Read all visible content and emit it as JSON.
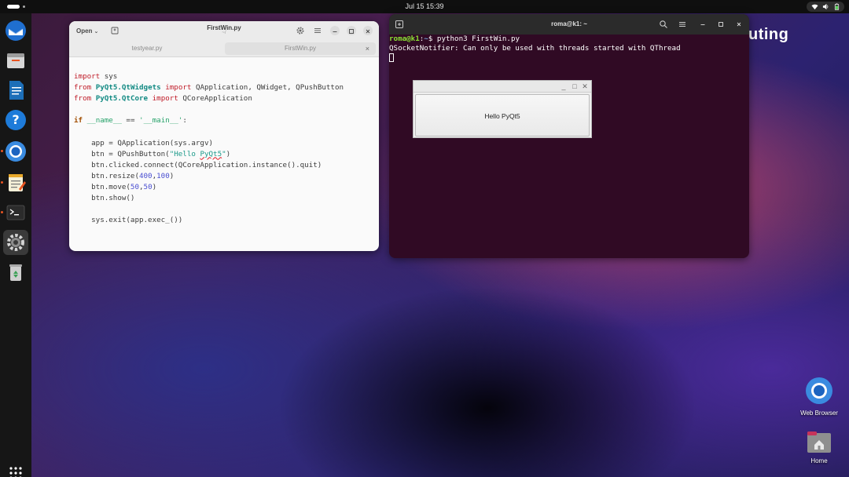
{
  "topbar": {
    "clock": "Jul 15  15:39"
  },
  "dock": {
    "items": [
      {
        "name": "thunderbird"
      },
      {
        "name": "files"
      },
      {
        "name": "libreoffice-writer"
      },
      {
        "name": "help"
      },
      {
        "name": "chromium"
      },
      {
        "name": "text-editor"
      },
      {
        "name": "terminal"
      },
      {
        "name": "settings"
      },
      {
        "name": "trash"
      }
    ]
  },
  "desktop": {
    "wallpaper_text": "uting",
    "icons": [
      {
        "label": "Web Browser"
      },
      {
        "label": "Home"
      }
    ]
  },
  "editor": {
    "open_label": "Open",
    "title": "FirstWin.py",
    "subtitle": "~/",
    "tabs": [
      {
        "label": "testyear.py"
      },
      {
        "label": "FirstWin.py"
      }
    ],
    "tab_close": "×",
    "code": {
      "l1_kw": "import",
      "l1_rest": " sys",
      "l2_kw": "from",
      "l2_mod": "PyQt5.QtWidgets",
      "l2_kw2": "import",
      "l2_rest": " QApplication, QWidget, QPushButton",
      "l3_kw": "from",
      "l3_mod": "PyQt5.QtCore",
      "l3_kw2": "import",
      "l3_rest": " QCoreApplication",
      "l5_kw": "if",
      "l5_name": "__name__",
      "l5_op": " == ",
      "l5_str": "'__main__'",
      "l5_colon": ":",
      "l7": "    app = QApplication(sys.argv)",
      "l8_a": "    btn = QPushButton(",
      "l8_str1": "\"Hello ",
      "l8_sq": "PyQt5",
      "l8_str2": "\"",
      "l8_b": ")",
      "l9": "    btn.clicked.connect(QCoreApplication.instance().quit)",
      "l10_a": "    btn.resize(",
      "l10_n1": "400",
      "l10_c": ",",
      "l10_n2": "100",
      "l10_b": ")",
      "l11_a": "    btn.move(",
      "l11_n1": "50",
      "l11_c": ",",
      "l11_n2": "50",
      "l11_b": ")",
      "l12": "    btn.show()",
      "l14": "    sys.exit(app.exec_())"
    }
  },
  "terminal": {
    "title": "roma@k1: ~",
    "prompt_user": "roma@k1",
    "prompt_sep": ":",
    "prompt_path": "~",
    "prompt_dollar": "$ ",
    "command": "python3 FirstWin.py",
    "output": "QSocketNotifier: Can only be used with threads started with QThread"
  },
  "qtwindow": {
    "button_label": "Hello PyQt5",
    "min": "_",
    "max": "□",
    "close": "✕"
  }
}
